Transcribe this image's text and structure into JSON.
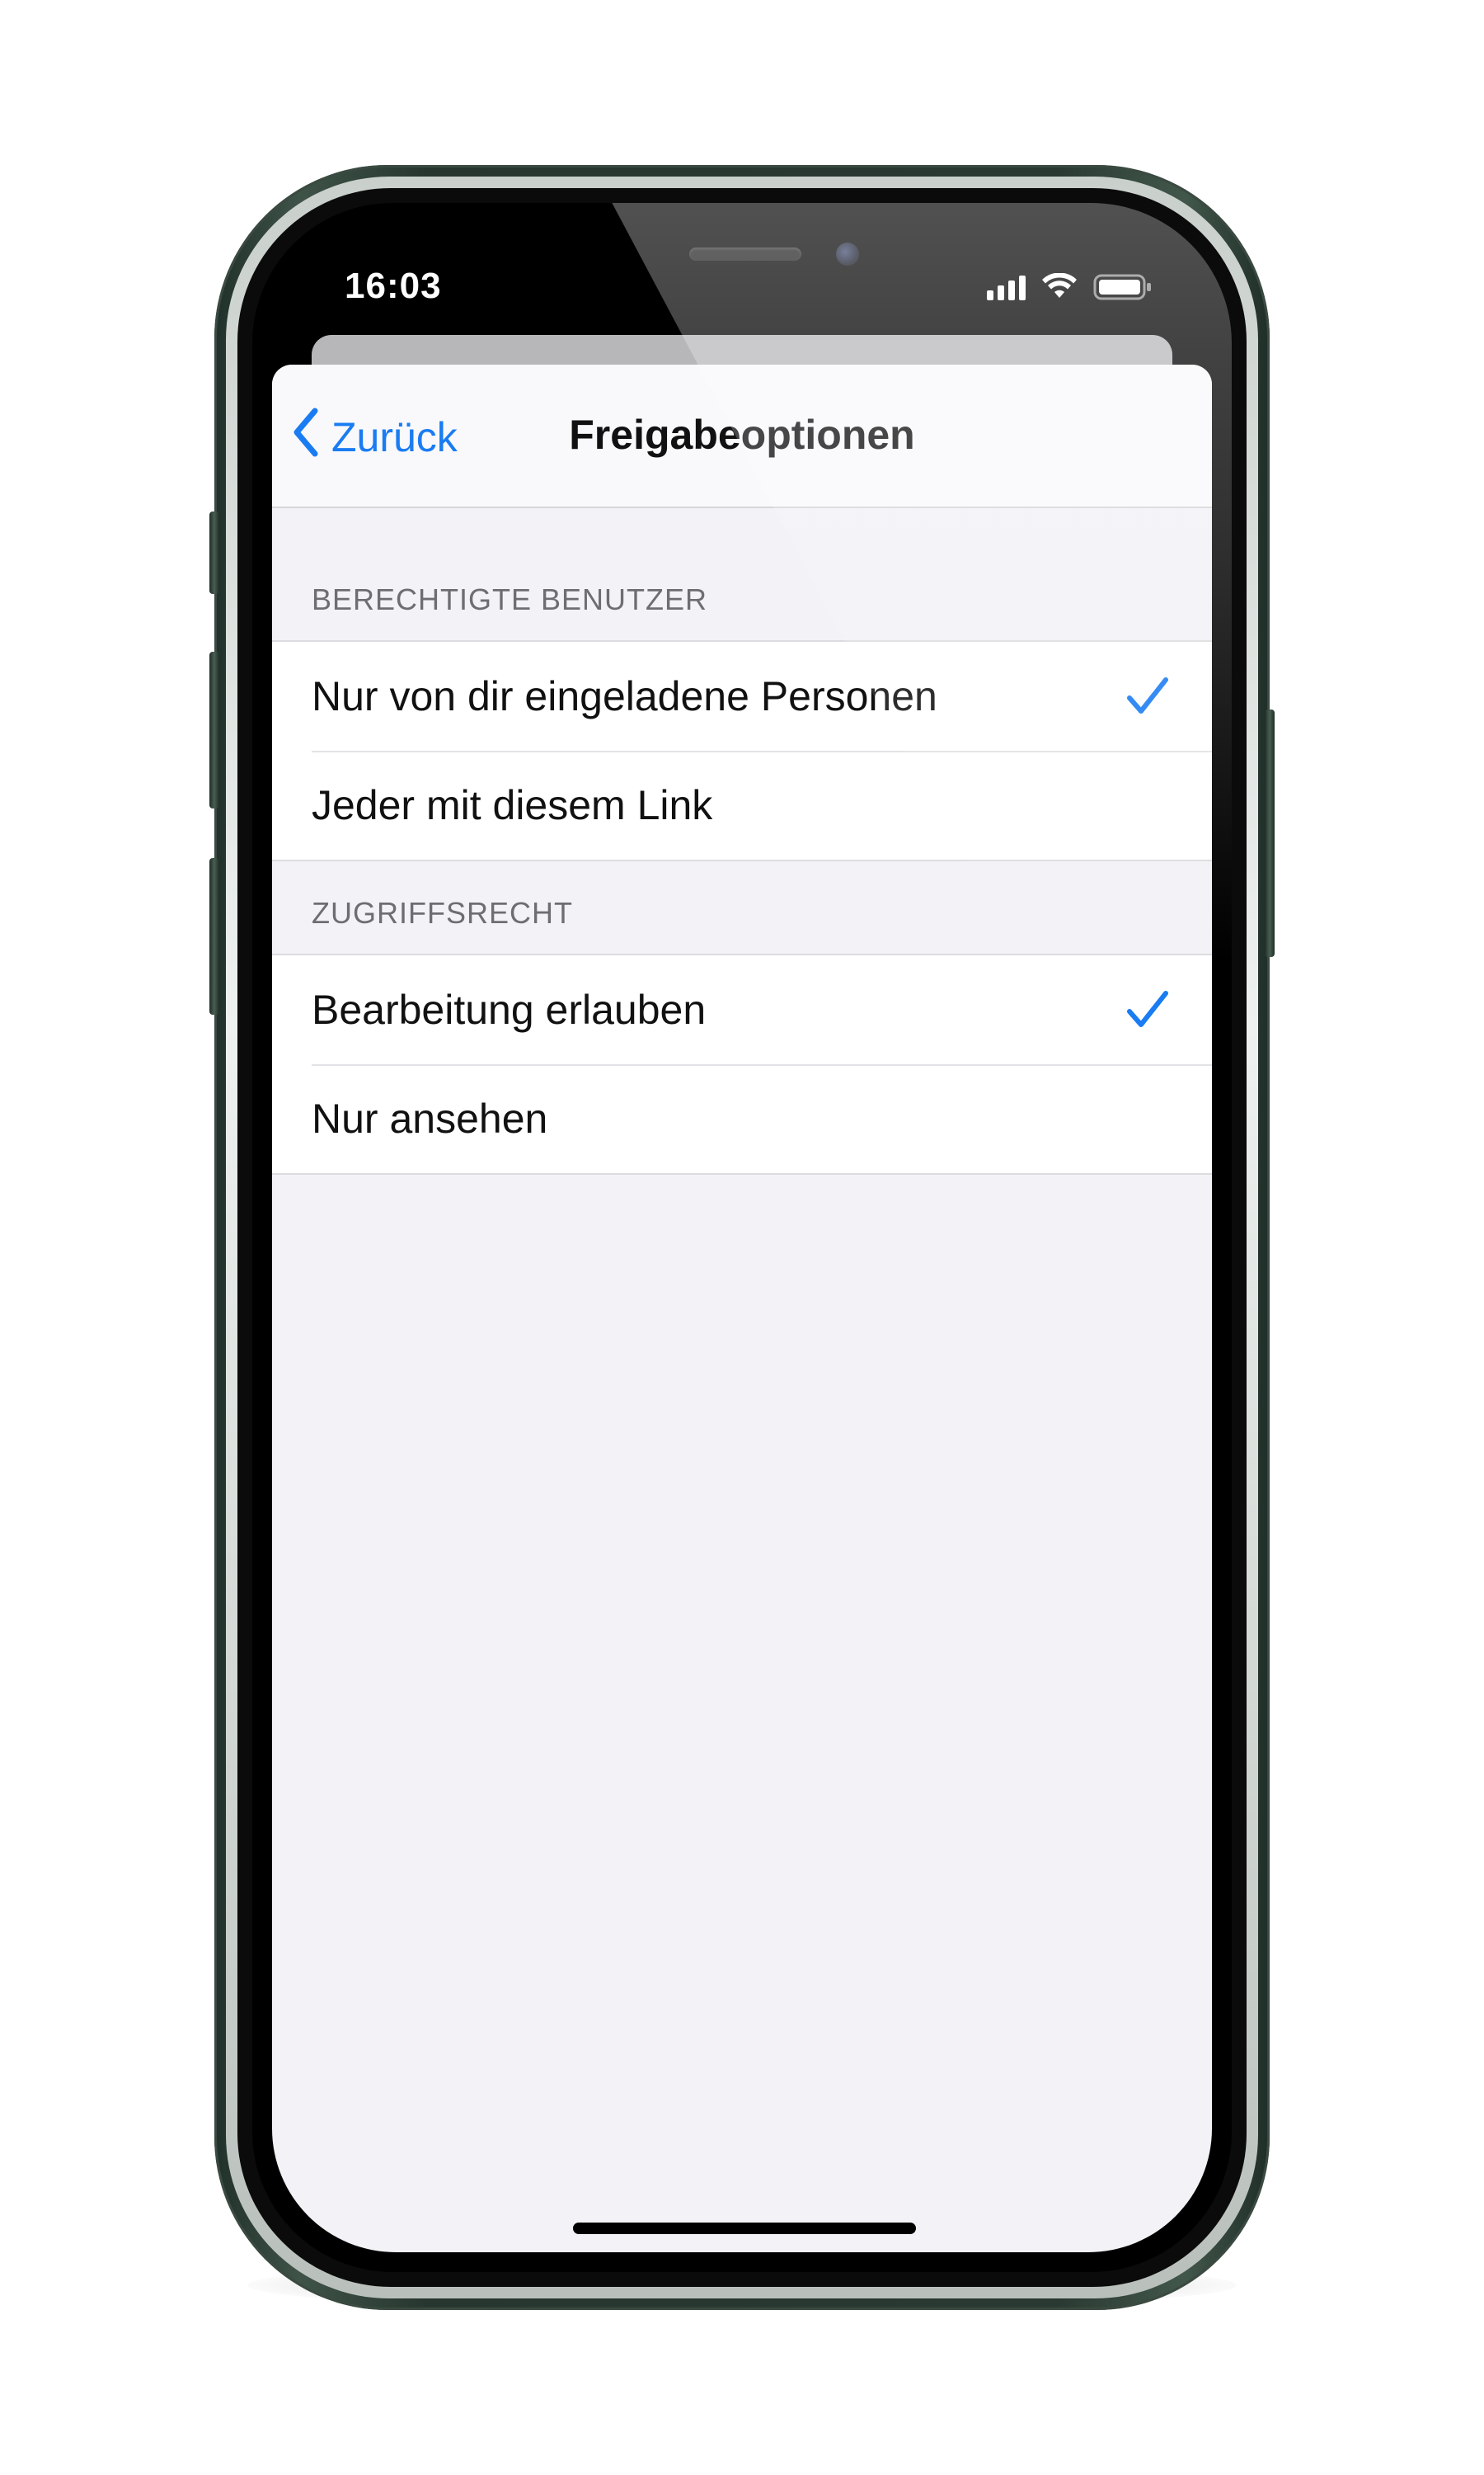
{
  "status_bar": {
    "time": "16:03",
    "signal_icon": "cellular-signal-icon",
    "wifi_icon": "wifi-icon",
    "battery_icon": "battery-icon"
  },
  "nav": {
    "back_label": "Zurück",
    "back_icon": "chevron-left-icon",
    "title": "Freigabeoptionen"
  },
  "sections": [
    {
      "header": "BERECHTIGTE BENUTZER",
      "rows": [
        {
          "label": "Nur von dir eingeladene Personen",
          "checked": true
        },
        {
          "label": "Jeder mit diesem Link",
          "checked": false
        }
      ]
    },
    {
      "header": "ZUGRIFFSRECHT",
      "rows": [
        {
          "label": "Bearbeitung erlauben",
          "checked": true
        },
        {
          "label": "Nur ansehen",
          "checked": false
        }
      ]
    }
  ],
  "colors": {
    "accent": "#1a7cf2",
    "grouped_background": "#f2f2f7",
    "cell_background": "#ffffff",
    "section_header_text": "#6d6d72",
    "phone_frame": "#2f4138"
  }
}
